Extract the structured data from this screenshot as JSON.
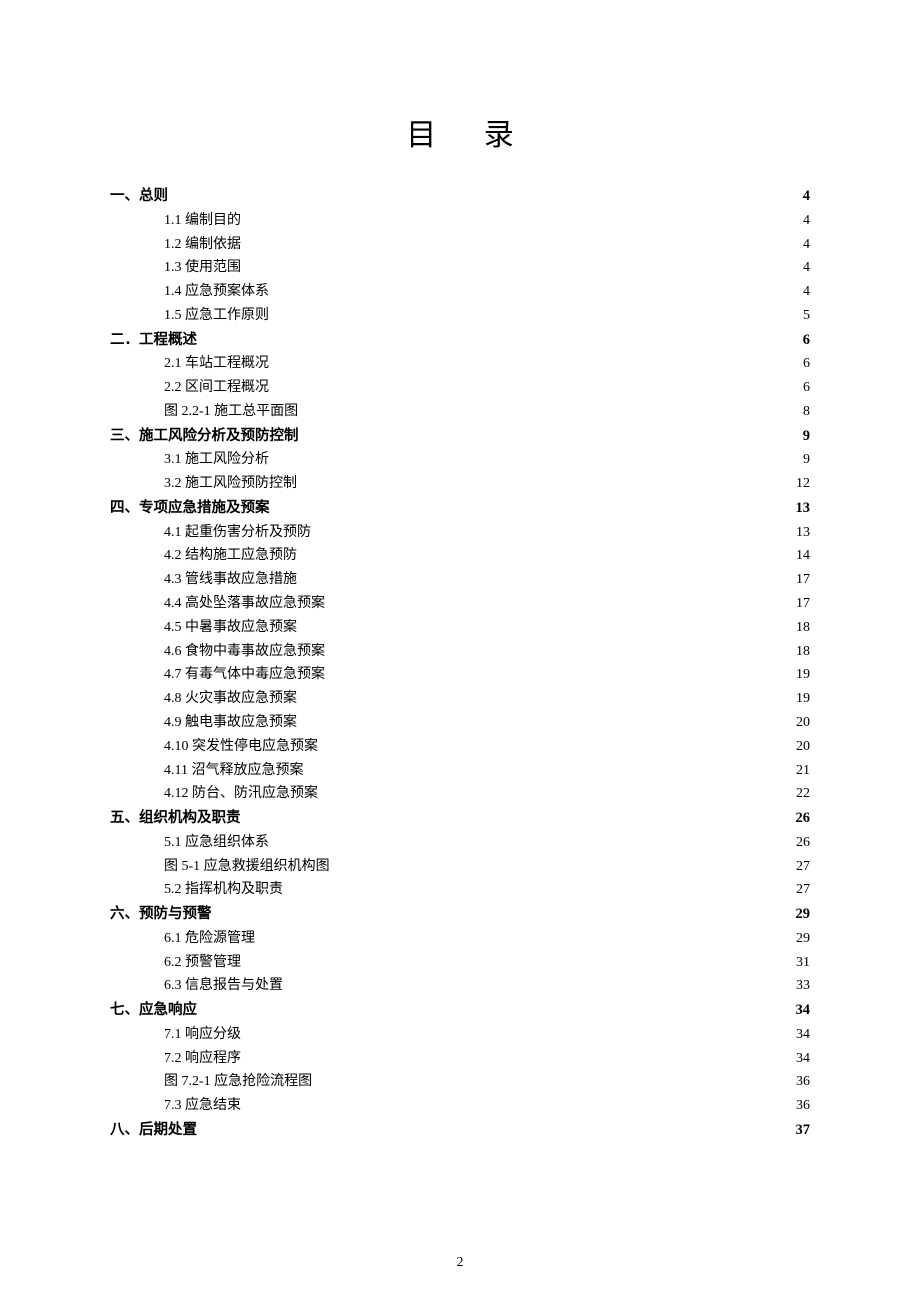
{
  "title": "目 录",
  "page_number": "2",
  "toc": [
    {
      "level": 1,
      "label": "一、总则",
      "page": "4"
    },
    {
      "level": 2,
      "label": "1.1 编制目的",
      "page": "4"
    },
    {
      "level": 2,
      "label": "1.2 编制依据",
      "page": "4"
    },
    {
      "level": 2,
      "label": "1.3 使用范围",
      "page": "4"
    },
    {
      "level": 2,
      "label": "1.4 应急预案体系",
      "page": "4"
    },
    {
      "level": 2,
      "label": "1.5 应急工作原则",
      "page": "5"
    },
    {
      "level": 1,
      "label": "二．工程概述",
      "page": "6"
    },
    {
      "level": 2,
      "label": "2.1 车站工程概况",
      "page": "6"
    },
    {
      "level": 2,
      "label": "2.2 区间工程概况",
      "page": "6"
    },
    {
      "level": 2,
      "label": "图 2.2-1 施工总平面图",
      "page": "8"
    },
    {
      "level": 1,
      "label": "三、施工风险分析及预防控制",
      "page": "9"
    },
    {
      "level": 2,
      "label": "3.1 施工风险分析",
      "page": "9"
    },
    {
      "level": 2,
      "label": "3.2 施工风险预防控制",
      "page": "12"
    },
    {
      "level": 1,
      "label": "四、专项应急措施及预案",
      "page": "13"
    },
    {
      "level": 2,
      "label": "4.1 起重伤害分析及预防",
      "page": "13"
    },
    {
      "level": 2,
      "label": "4.2 结构施工应急预防",
      "page": "14"
    },
    {
      "level": 2,
      "label": "4.3 管线事故应急措施",
      "page": "17"
    },
    {
      "level": 2,
      "label": "4.4 高处坠落事故应急预案",
      "page": "17"
    },
    {
      "level": 2,
      "label": "4.5 中暑事故应急预案",
      "page": "18"
    },
    {
      "level": 2,
      "label": "4.6 食物中毒事故应急预案",
      "page": "18"
    },
    {
      "level": 2,
      "label": "4.7 有毒气体中毒应急预案",
      "page": "19"
    },
    {
      "level": 2,
      "label": "4.8 火灾事故应急预案",
      "page": "19"
    },
    {
      "level": 2,
      "label": "4.9 触电事故应急预案",
      "page": "20"
    },
    {
      "level": 2,
      "label": "4.10 突发性停电应急预案",
      "page": "20"
    },
    {
      "level": 2,
      "label": "4.11 沼气释放应急预案",
      "page": "21"
    },
    {
      "level": 2,
      "label": "4.12 防台、防汛应急预案",
      "page": "22"
    },
    {
      "level": 1,
      "label": "五、组织机构及职责",
      "page": "26"
    },
    {
      "level": 2,
      "label": "5.1 应急组织体系",
      "page": "26"
    },
    {
      "level": 2,
      "label": "图 5-1 应急救援组织机构图",
      "page": "27"
    },
    {
      "level": 2,
      "label": "5.2 指挥机构及职责",
      "page": "27"
    },
    {
      "level": 1,
      "label": "六、预防与预警",
      "page": "29"
    },
    {
      "level": 2,
      "label": "6.1 危险源管理",
      "page": "29"
    },
    {
      "level": 2,
      "label": "6.2 预警管理",
      "page": "31"
    },
    {
      "level": 2,
      "label": "6.3 信息报告与处置",
      "page": "33"
    },
    {
      "level": 1,
      "label": "七、应急响应",
      "page": "34"
    },
    {
      "level": 2,
      "label": "7.1 响应分级",
      "page": "34"
    },
    {
      "level": 2,
      "label": "7.2 响应程序",
      "page": "34"
    },
    {
      "level": 2,
      "label": "图 7.2-1   应急抢险流程图",
      "page": "36"
    },
    {
      "level": 2,
      "label": "7.3 应急结束",
      "page": "36"
    },
    {
      "level": 1,
      "label": "八、后期处置",
      "page": "37"
    }
  ]
}
